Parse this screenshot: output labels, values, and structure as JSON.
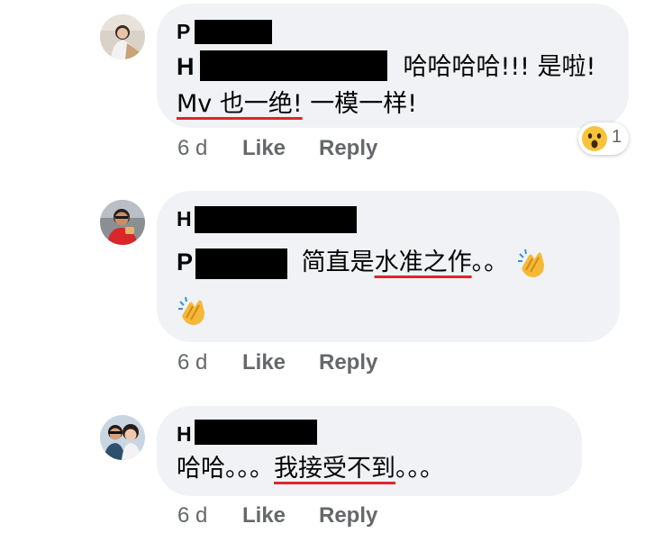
{
  "comments": [
    {
      "author": "P",
      "mention": "H",
      "line1_rest": "哈哈哈哈!!! 是啦!",
      "line2_underlined": "Mv 也一绝!",
      "line2_rest": " 一模一样!",
      "time": "6 d",
      "like_label": "Like",
      "reply_label": "Reply",
      "reaction": {
        "icon": "wow-emoji-icon",
        "count": "1"
      }
    },
    {
      "author": "H",
      "mention": "P",
      "text_before": " 简直是",
      "text_underlined": "水准之作",
      "text_after": "。。",
      "time": "6 d",
      "like_label": "Like",
      "reply_label": "Reply"
    },
    {
      "author": "H",
      "text_before": "哈哈。。。",
      "text_underlined": "我接受不到",
      "text_after": "。。。",
      "time": "6 d",
      "like_label": "Like",
      "reply_label": "Reply"
    }
  ],
  "colors": {
    "bubble": "#f0f2f5",
    "meta": "#65676b",
    "underline": "#e0242c",
    "redaction": "#000000"
  }
}
